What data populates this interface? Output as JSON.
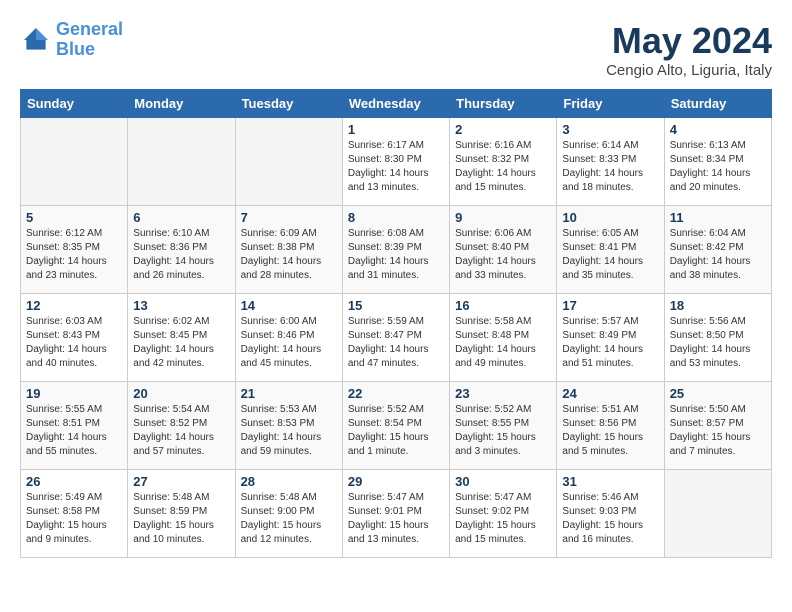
{
  "header": {
    "logo_line1": "General",
    "logo_line2": "Blue",
    "month": "May 2024",
    "location": "Cengio Alto, Liguria, Italy"
  },
  "weekdays": [
    "Sunday",
    "Monday",
    "Tuesday",
    "Wednesday",
    "Thursday",
    "Friday",
    "Saturday"
  ],
  "weeks": [
    [
      {
        "day": "",
        "empty": true
      },
      {
        "day": "",
        "empty": true
      },
      {
        "day": "",
        "empty": true
      },
      {
        "day": "1",
        "sunrise": "Sunrise: 6:17 AM",
        "sunset": "Sunset: 8:30 PM",
        "daylight": "Daylight: 14 hours and 13 minutes."
      },
      {
        "day": "2",
        "sunrise": "Sunrise: 6:16 AM",
        "sunset": "Sunset: 8:32 PM",
        "daylight": "Daylight: 14 hours and 15 minutes."
      },
      {
        "day": "3",
        "sunrise": "Sunrise: 6:14 AM",
        "sunset": "Sunset: 8:33 PM",
        "daylight": "Daylight: 14 hours and 18 minutes."
      },
      {
        "day": "4",
        "sunrise": "Sunrise: 6:13 AM",
        "sunset": "Sunset: 8:34 PM",
        "daylight": "Daylight: 14 hours and 20 minutes."
      }
    ],
    [
      {
        "day": "5",
        "sunrise": "Sunrise: 6:12 AM",
        "sunset": "Sunset: 8:35 PM",
        "daylight": "Daylight: 14 hours and 23 minutes."
      },
      {
        "day": "6",
        "sunrise": "Sunrise: 6:10 AM",
        "sunset": "Sunset: 8:36 PM",
        "daylight": "Daylight: 14 hours and 26 minutes."
      },
      {
        "day": "7",
        "sunrise": "Sunrise: 6:09 AM",
        "sunset": "Sunset: 8:38 PM",
        "daylight": "Daylight: 14 hours and 28 minutes."
      },
      {
        "day": "8",
        "sunrise": "Sunrise: 6:08 AM",
        "sunset": "Sunset: 8:39 PM",
        "daylight": "Daylight: 14 hours and 31 minutes."
      },
      {
        "day": "9",
        "sunrise": "Sunrise: 6:06 AM",
        "sunset": "Sunset: 8:40 PM",
        "daylight": "Daylight: 14 hours and 33 minutes."
      },
      {
        "day": "10",
        "sunrise": "Sunrise: 6:05 AM",
        "sunset": "Sunset: 8:41 PM",
        "daylight": "Daylight: 14 hours and 35 minutes."
      },
      {
        "day": "11",
        "sunrise": "Sunrise: 6:04 AM",
        "sunset": "Sunset: 8:42 PM",
        "daylight": "Daylight: 14 hours and 38 minutes."
      }
    ],
    [
      {
        "day": "12",
        "sunrise": "Sunrise: 6:03 AM",
        "sunset": "Sunset: 8:43 PM",
        "daylight": "Daylight: 14 hours and 40 minutes."
      },
      {
        "day": "13",
        "sunrise": "Sunrise: 6:02 AM",
        "sunset": "Sunset: 8:45 PM",
        "daylight": "Daylight: 14 hours and 42 minutes."
      },
      {
        "day": "14",
        "sunrise": "Sunrise: 6:00 AM",
        "sunset": "Sunset: 8:46 PM",
        "daylight": "Daylight: 14 hours and 45 minutes."
      },
      {
        "day": "15",
        "sunrise": "Sunrise: 5:59 AM",
        "sunset": "Sunset: 8:47 PM",
        "daylight": "Daylight: 14 hours and 47 minutes."
      },
      {
        "day": "16",
        "sunrise": "Sunrise: 5:58 AM",
        "sunset": "Sunset: 8:48 PM",
        "daylight": "Daylight: 14 hours and 49 minutes."
      },
      {
        "day": "17",
        "sunrise": "Sunrise: 5:57 AM",
        "sunset": "Sunset: 8:49 PM",
        "daylight": "Daylight: 14 hours and 51 minutes."
      },
      {
        "day": "18",
        "sunrise": "Sunrise: 5:56 AM",
        "sunset": "Sunset: 8:50 PM",
        "daylight": "Daylight: 14 hours and 53 minutes."
      }
    ],
    [
      {
        "day": "19",
        "sunrise": "Sunrise: 5:55 AM",
        "sunset": "Sunset: 8:51 PM",
        "daylight": "Daylight: 14 hours and 55 minutes."
      },
      {
        "day": "20",
        "sunrise": "Sunrise: 5:54 AM",
        "sunset": "Sunset: 8:52 PM",
        "daylight": "Daylight: 14 hours and 57 minutes."
      },
      {
        "day": "21",
        "sunrise": "Sunrise: 5:53 AM",
        "sunset": "Sunset: 8:53 PM",
        "daylight": "Daylight: 14 hours and 59 minutes."
      },
      {
        "day": "22",
        "sunrise": "Sunrise: 5:52 AM",
        "sunset": "Sunset: 8:54 PM",
        "daylight": "Daylight: 15 hours and 1 minute."
      },
      {
        "day": "23",
        "sunrise": "Sunrise: 5:52 AM",
        "sunset": "Sunset: 8:55 PM",
        "daylight": "Daylight: 15 hours and 3 minutes."
      },
      {
        "day": "24",
        "sunrise": "Sunrise: 5:51 AM",
        "sunset": "Sunset: 8:56 PM",
        "daylight": "Daylight: 15 hours and 5 minutes."
      },
      {
        "day": "25",
        "sunrise": "Sunrise: 5:50 AM",
        "sunset": "Sunset: 8:57 PM",
        "daylight": "Daylight: 15 hours and 7 minutes."
      }
    ],
    [
      {
        "day": "26",
        "sunrise": "Sunrise: 5:49 AM",
        "sunset": "Sunset: 8:58 PM",
        "daylight": "Daylight: 15 hours and 9 minutes."
      },
      {
        "day": "27",
        "sunrise": "Sunrise: 5:48 AM",
        "sunset": "Sunset: 8:59 PM",
        "daylight": "Daylight: 15 hours and 10 minutes."
      },
      {
        "day": "28",
        "sunrise": "Sunrise: 5:48 AM",
        "sunset": "Sunset: 9:00 PM",
        "daylight": "Daylight: 15 hours and 12 minutes."
      },
      {
        "day": "29",
        "sunrise": "Sunrise: 5:47 AM",
        "sunset": "Sunset: 9:01 PM",
        "daylight": "Daylight: 15 hours and 13 minutes."
      },
      {
        "day": "30",
        "sunrise": "Sunrise: 5:47 AM",
        "sunset": "Sunset: 9:02 PM",
        "daylight": "Daylight: 15 hours and 15 minutes."
      },
      {
        "day": "31",
        "sunrise": "Sunrise: 5:46 AM",
        "sunset": "Sunset: 9:03 PM",
        "daylight": "Daylight: 15 hours and 16 minutes."
      },
      {
        "day": "",
        "empty": true
      }
    ]
  ]
}
